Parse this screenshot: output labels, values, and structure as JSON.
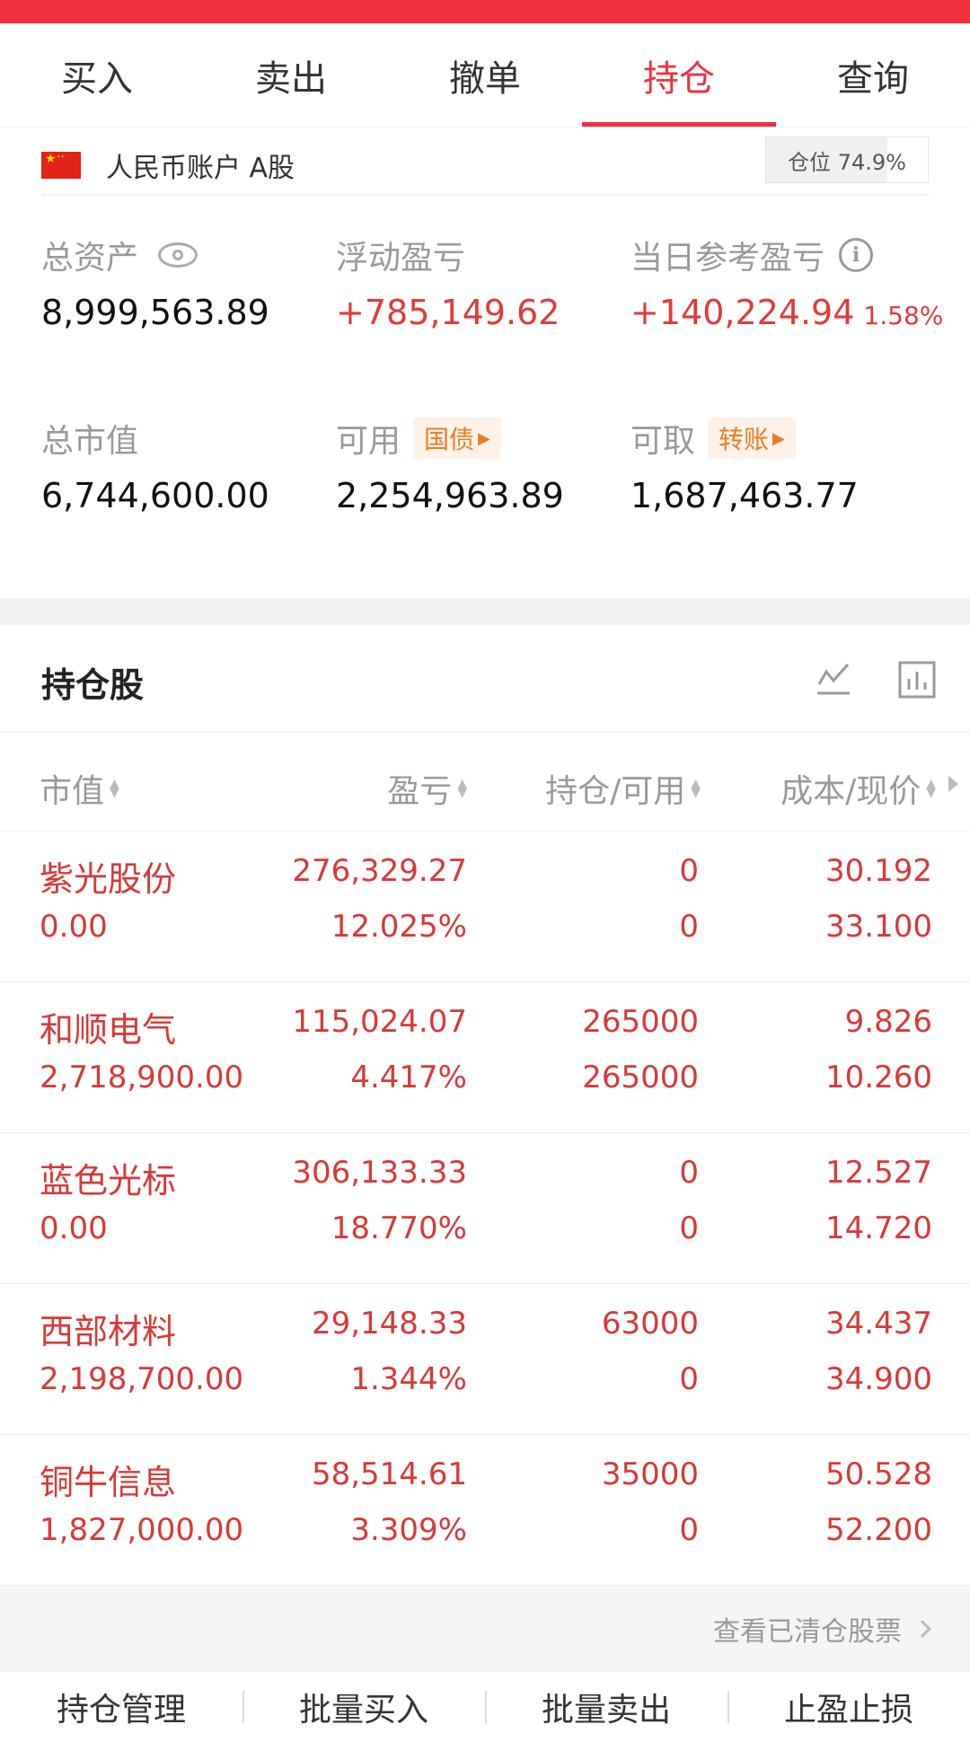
{
  "tabs": [
    {
      "label": "买入"
    },
    {
      "label": "卖出"
    },
    {
      "label": "撤单"
    },
    {
      "label": "持仓"
    },
    {
      "label": "查询"
    }
  ],
  "active_tab": "持仓",
  "account": {
    "label": "人民币账户 A股",
    "position_ratio": "仓位 74.9%",
    "position_ratio_value": 0.749
  },
  "metrics": {
    "total_assets": {
      "label": "总资产",
      "value": "8,999,563.89"
    },
    "floating_pnl": {
      "label": "浮动盈亏",
      "value": "+785,149.62"
    },
    "daily_pnl": {
      "label": "当日参考盈亏",
      "value": "+140,224.94",
      "pct": "1.58%"
    },
    "market_value": {
      "label": "总市值",
      "value": "6,744,600.00"
    },
    "available": {
      "label": "可用",
      "tag": "国债",
      "value": "2,254,963.89"
    },
    "withdrawable": {
      "label": "可取",
      "tag": "转账",
      "value": "1,687,463.77"
    }
  },
  "holdings_section": {
    "title": "持仓股"
  },
  "columns": {
    "market_value": "市值",
    "pnl": "盈亏",
    "position": "持仓/可用",
    "cost": "成本/现价"
  },
  "holdings": [
    {
      "name": "紫光股份",
      "market_value": "0.00",
      "pnl": "276,329.27",
      "pnl_pct": "12.025%",
      "position": "0",
      "available": "0",
      "cost": "30.192",
      "price": "33.100"
    },
    {
      "name": "和顺电气",
      "market_value": "2,718,900.00",
      "pnl": "115,024.07",
      "pnl_pct": "4.417%",
      "position": "265000",
      "available": "265000",
      "cost": "9.826",
      "price": "10.260"
    },
    {
      "name": "蓝色光标",
      "market_value": "0.00",
      "pnl": "306,133.33",
      "pnl_pct": "18.770%",
      "position": "0",
      "available": "0",
      "cost": "12.527",
      "price": "14.720"
    },
    {
      "name": "西部材料",
      "market_value": "2,198,700.00",
      "pnl": "29,148.33",
      "pnl_pct": "1.344%",
      "position": "63000",
      "available": "0",
      "cost": "34.437",
      "price": "34.900"
    },
    {
      "name": "铜牛信息",
      "market_value": "1,827,000.00",
      "pnl": "58,514.61",
      "pnl_pct": "3.309%",
      "position": "35000",
      "available": "0",
      "cost": "50.528",
      "price": "52.200"
    }
  ],
  "cleared_link": "查看已清仓股票",
  "bottom_actions": [
    {
      "label": "持仓管理"
    },
    {
      "label": "批量买入"
    },
    {
      "label": "批量卖出"
    },
    {
      "label": "止盈止损"
    }
  ],
  "colors": {
    "accent": "#f0303f",
    "profit": "#d93838",
    "tag": "#e67e22"
  }
}
